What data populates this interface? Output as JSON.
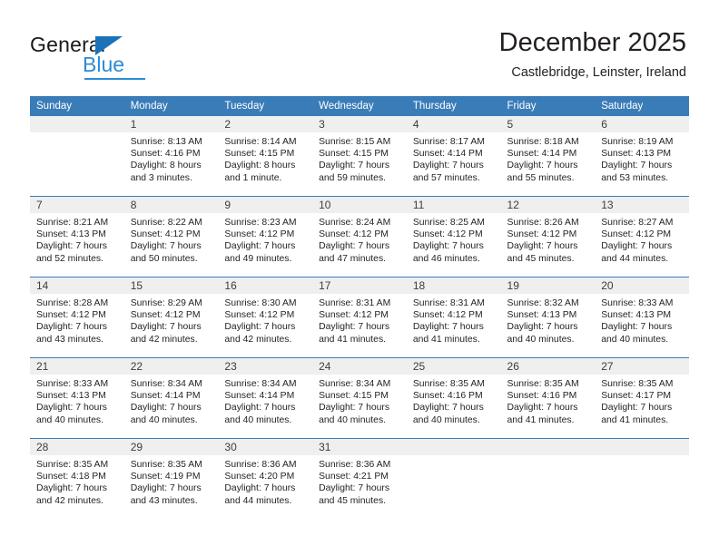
{
  "brand": {
    "name_top": "General",
    "name_bottom": "Blue",
    "triangle_color": "#1b72b8",
    "blue_color": "#2d8bd4"
  },
  "header": {
    "title": "December 2025",
    "subtitle": "Castlebridge, Leinster, Ireland"
  },
  "theme": {
    "header_blue": "#3a7cb8",
    "daynum_band": "#efefef",
    "text": "#231f20"
  },
  "weekdays": [
    "Sunday",
    "Monday",
    "Tuesday",
    "Wednesday",
    "Thursday",
    "Friday",
    "Saturday"
  ],
  "labels": {
    "sunrise": "Sunrise:",
    "sunset": "Sunset:",
    "daylight": "Daylight:"
  },
  "weeks": [
    [
      {
        "day": "",
        "sunrise": "",
        "sunset": "",
        "daylight_1": "",
        "daylight_2": "",
        "blank": true
      },
      {
        "day": "1",
        "sunrise": "Sunrise: 8:13 AM",
        "sunset": "Sunset: 4:16 PM",
        "daylight_1": "Daylight: 8 hours",
        "daylight_2": "and 3 minutes."
      },
      {
        "day": "2",
        "sunrise": "Sunrise: 8:14 AM",
        "sunset": "Sunset: 4:15 PM",
        "daylight_1": "Daylight: 8 hours",
        "daylight_2": "and 1 minute."
      },
      {
        "day": "3",
        "sunrise": "Sunrise: 8:15 AM",
        "sunset": "Sunset: 4:15 PM",
        "daylight_1": "Daylight: 7 hours",
        "daylight_2": "and 59 minutes."
      },
      {
        "day": "4",
        "sunrise": "Sunrise: 8:17 AM",
        "sunset": "Sunset: 4:14 PM",
        "daylight_1": "Daylight: 7 hours",
        "daylight_2": "and 57 minutes."
      },
      {
        "day": "5",
        "sunrise": "Sunrise: 8:18 AM",
        "sunset": "Sunset: 4:14 PM",
        "daylight_1": "Daylight: 7 hours",
        "daylight_2": "and 55 minutes."
      },
      {
        "day": "6",
        "sunrise": "Sunrise: 8:19 AM",
        "sunset": "Sunset: 4:13 PM",
        "daylight_1": "Daylight: 7 hours",
        "daylight_2": "and 53 minutes."
      }
    ],
    [
      {
        "day": "7",
        "sunrise": "Sunrise: 8:21 AM",
        "sunset": "Sunset: 4:13 PM",
        "daylight_1": "Daylight: 7 hours",
        "daylight_2": "and 52 minutes."
      },
      {
        "day": "8",
        "sunrise": "Sunrise: 8:22 AM",
        "sunset": "Sunset: 4:12 PM",
        "daylight_1": "Daylight: 7 hours",
        "daylight_2": "and 50 minutes."
      },
      {
        "day": "9",
        "sunrise": "Sunrise: 8:23 AM",
        "sunset": "Sunset: 4:12 PM",
        "daylight_1": "Daylight: 7 hours",
        "daylight_2": "and 49 minutes."
      },
      {
        "day": "10",
        "sunrise": "Sunrise: 8:24 AM",
        "sunset": "Sunset: 4:12 PM",
        "daylight_1": "Daylight: 7 hours",
        "daylight_2": "and 47 minutes."
      },
      {
        "day": "11",
        "sunrise": "Sunrise: 8:25 AM",
        "sunset": "Sunset: 4:12 PM",
        "daylight_1": "Daylight: 7 hours",
        "daylight_2": "and 46 minutes."
      },
      {
        "day": "12",
        "sunrise": "Sunrise: 8:26 AM",
        "sunset": "Sunset: 4:12 PM",
        "daylight_1": "Daylight: 7 hours",
        "daylight_2": "and 45 minutes."
      },
      {
        "day": "13",
        "sunrise": "Sunrise: 8:27 AM",
        "sunset": "Sunset: 4:12 PM",
        "daylight_1": "Daylight: 7 hours",
        "daylight_2": "and 44 minutes."
      }
    ],
    [
      {
        "day": "14",
        "sunrise": "Sunrise: 8:28 AM",
        "sunset": "Sunset: 4:12 PM",
        "daylight_1": "Daylight: 7 hours",
        "daylight_2": "and 43 minutes."
      },
      {
        "day": "15",
        "sunrise": "Sunrise: 8:29 AM",
        "sunset": "Sunset: 4:12 PM",
        "daylight_1": "Daylight: 7 hours",
        "daylight_2": "and 42 minutes."
      },
      {
        "day": "16",
        "sunrise": "Sunrise: 8:30 AM",
        "sunset": "Sunset: 4:12 PM",
        "daylight_1": "Daylight: 7 hours",
        "daylight_2": "and 42 minutes."
      },
      {
        "day": "17",
        "sunrise": "Sunrise: 8:31 AM",
        "sunset": "Sunset: 4:12 PM",
        "daylight_1": "Daylight: 7 hours",
        "daylight_2": "and 41 minutes."
      },
      {
        "day": "18",
        "sunrise": "Sunrise: 8:31 AM",
        "sunset": "Sunset: 4:12 PM",
        "daylight_1": "Daylight: 7 hours",
        "daylight_2": "and 41 minutes."
      },
      {
        "day": "19",
        "sunrise": "Sunrise: 8:32 AM",
        "sunset": "Sunset: 4:13 PM",
        "daylight_1": "Daylight: 7 hours",
        "daylight_2": "and 40 minutes."
      },
      {
        "day": "20",
        "sunrise": "Sunrise: 8:33 AM",
        "sunset": "Sunset: 4:13 PM",
        "daylight_1": "Daylight: 7 hours",
        "daylight_2": "and 40 minutes."
      }
    ],
    [
      {
        "day": "21",
        "sunrise": "Sunrise: 8:33 AM",
        "sunset": "Sunset: 4:13 PM",
        "daylight_1": "Daylight: 7 hours",
        "daylight_2": "and 40 minutes."
      },
      {
        "day": "22",
        "sunrise": "Sunrise: 8:34 AM",
        "sunset": "Sunset: 4:14 PM",
        "daylight_1": "Daylight: 7 hours",
        "daylight_2": "and 40 minutes."
      },
      {
        "day": "23",
        "sunrise": "Sunrise: 8:34 AM",
        "sunset": "Sunset: 4:14 PM",
        "daylight_1": "Daylight: 7 hours",
        "daylight_2": "and 40 minutes."
      },
      {
        "day": "24",
        "sunrise": "Sunrise: 8:34 AM",
        "sunset": "Sunset: 4:15 PM",
        "daylight_1": "Daylight: 7 hours",
        "daylight_2": "and 40 minutes."
      },
      {
        "day": "25",
        "sunrise": "Sunrise: 8:35 AM",
        "sunset": "Sunset: 4:16 PM",
        "daylight_1": "Daylight: 7 hours",
        "daylight_2": "and 40 minutes."
      },
      {
        "day": "26",
        "sunrise": "Sunrise: 8:35 AM",
        "sunset": "Sunset: 4:16 PM",
        "daylight_1": "Daylight: 7 hours",
        "daylight_2": "and 41 minutes."
      },
      {
        "day": "27",
        "sunrise": "Sunrise: 8:35 AM",
        "sunset": "Sunset: 4:17 PM",
        "daylight_1": "Daylight: 7 hours",
        "daylight_2": "and 41 minutes."
      }
    ],
    [
      {
        "day": "28",
        "sunrise": "Sunrise: 8:35 AM",
        "sunset": "Sunset: 4:18 PM",
        "daylight_1": "Daylight: 7 hours",
        "daylight_2": "and 42 minutes."
      },
      {
        "day": "29",
        "sunrise": "Sunrise: 8:35 AM",
        "sunset": "Sunset: 4:19 PM",
        "daylight_1": "Daylight: 7 hours",
        "daylight_2": "and 43 minutes."
      },
      {
        "day": "30",
        "sunrise": "Sunrise: 8:36 AM",
        "sunset": "Sunset: 4:20 PM",
        "daylight_1": "Daylight: 7 hours",
        "daylight_2": "and 44 minutes."
      },
      {
        "day": "31",
        "sunrise": "Sunrise: 8:36 AM",
        "sunset": "Sunset: 4:21 PM",
        "daylight_1": "Daylight: 7 hours",
        "daylight_2": "and 45 minutes."
      },
      {
        "day": "",
        "sunrise": "",
        "sunset": "",
        "daylight_1": "",
        "daylight_2": "",
        "blank": true
      },
      {
        "day": "",
        "sunrise": "",
        "sunset": "",
        "daylight_1": "",
        "daylight_2": "",
        "blank": true
      },
      {
        "day": "",
        "sunrise": "",
        "sunset": "",
        "daylight_1": "",
        "daylight_2": "",
        "blank": true
      }
    ]
  ]
}
